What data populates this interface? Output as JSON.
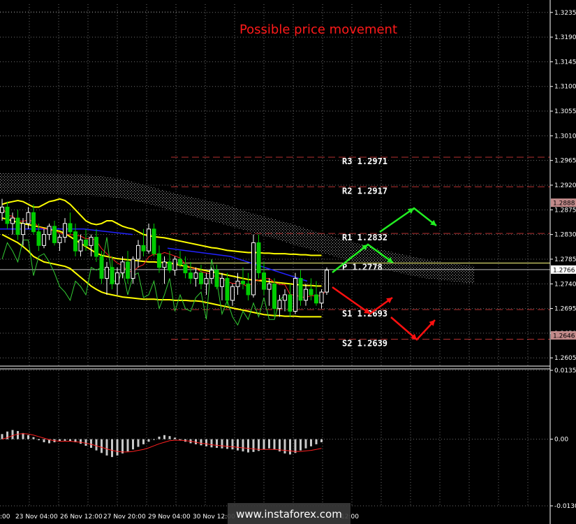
{
  "title": "Possible price movement",
  "watermark": "www.instaforex.com",
  "colors": {
    "background": "#000000",
    "grid": "#6e6e6e",
    "bull_candle": "#ffffff",
    "bear_candle": "#00cc00",
    "ichimoku_cloud": "#cccccc",
    "bollinger": "#ffff00",
    "ma_blue": "#2222ff",
    "ma_red": "#ff2020",
    "chikou_green": "#33cc33",
    "pivot_line_red": "#b33030",
    "pivot_line_yellow": "#ffff80",
    "arrow_green": "#22ee22",
    "arrow_red": "#ff1010",
    "macd_hist": "#c8c8c8",
    "macd_signal": "#ff2020"
  },
  "chart_data": {
    "type": "candlestick",
    "price_axis": {
      "ticks": [
        "1.3235",
        "1.3190",
        "1.3145",
        "1.3100",
        "1.3055",
        "1.3010",
        "1.2965",
        "1.2920",
        "1.2875",
        "1.2830",
        "1.2785",
        "1.2740",
        "1.2695",
        "1.2650",
        "1.2605"
      ],
      "min": 1.259,
      "max": 1.325,
      "current_price_tag": "1.2766",
      "tag_upper": "1.2888",
      "tag_lower": "1.2646"
    },
    "time_axis": {
      "labels": [
        ":00",
        "23 Nov 04:00",
        "26 Nov 12:00",
        "27 Nov 20:00",
        "29 Nov 04:00",
        "30 Nov 12:00",
        "",
        "",
        "12:00"
      ]
    },
    "pivot_levels": [
      {
        "name": "R3",
        "value": "1.2971",
        "label": "R3  1.2971",
        "style": "red"
      },
      {
        "name": "R2",
        "value": "1.2917",
        "label": "R2  1.2917",
        "style": "red"
      },
      {
        "name": "R1",
        "value": "1.2832",
        "label": "R1  1.2832",
        "style": "red"
      },
      {
        "name": "P",
        "value": "1.2778",
        "label": "P  1.2778",
        "style": "yellow"
      },
      {
        "name": "S1",
        "value": "1.2693",
        "label": "S1  1.2693",
        "style": "red"
      },
      {
        "name": "S2",
        "value": "1.2639",
        "label": "S2  1.2639",
        "style": "red"
      }
    ],
    "candles": [
      [
        1.287,
        1.2895,
        1.2855,
        1.288
      ],
      [
        1.288,
        1.289,
        1.284,
        1.285
      ],
      [
        1.285,
        1.287,
        1.283,
        1.286
      ],
      [
        1.286,
        1.2875,
        1.282,
        1.283
      ],
      [
        1.283,
        1.286,
        1.281,
        1.285
      ],
      [
        1.285,
        1.288,
        1.284,
        1.287
      ],
      [
        1.287,
        1.2885,
        1.283,
        1.2835
      ],
      [
        1.2835,
        1.285,
        1.28,
        1.281
      ],
      [
        1.281,
        1.284,
        1.2805,
        1.283
      ],
      [
        1.283,
        1.285,
        1.282,
        1.2845
      ],
      [
        1.2845,
        1.2855,
        1.281,
        1.2815
      ],
      [
        1.2815,
        1.283,
        1.28,
        1.2825
      ],
      [
        1.2825,
        1.286,
        1.2815,
        1.285
      ],
      [
        1.285,
        1.287,
        1.283,
        1.2835
      ],
      [
        1.2835,
        1.285,
        1.279,
        1.28
      ],
      [
        1.28,
        1.283,
        1.279,
        1.282
      ],
      [
        1.282,
        1.284,
        1.28,
        1.281
      ],
      [
        1.281,
        1.283,
        1.279,
        1.2825
      ],
      [
        1.2825,
        1.284,
        1.278,
        1.279
      ],
      [
        1.279,
        1.28,
        1.274,
        1.275
      ],
      [
        1.275,
        1.278,
        1.272,
        1.277
      ],
      [
        1.277,
        1.279,
        1.273,
        1.274
      ],
      [
        1.274,
        1.277,
        1.272,
        1.276
      ],
      [
        1.276,
        1.279,
        1.275,
        1.278
      ],
      [
        1.278,
        1.28,
        1.274,
        1.275
      ],
      [
        1.275,
        1.279,
        1.274,
        1.2785
      ],
      [
        1.2785,
        1.282,
        1.277,
        1.281
      ],
      [
        1.281,
        1.284,
        1.279,
        1.28
      ],
      [
        1.28,
        1.285,
        1.2795,
        1.284
      ],
      [
        1.284,
        1.285,
        1.279,
        1.2795
      ],
      [
        1.2795,
        1.281,
        1.276,
        1.277
      ],
      [
        1.277,
        1.279,
        1.274,
        1.278
      ],
      [
        1.278,
        1.28,
        1.276,
        1.2765
      ],
      [
        1.2765,
        1.279,
        1.2755,
        1.2785
      ],
      [
        1.2785,
        1.28,
        1.277,
        1.2775
      ],
      [
        1.2775,
        1.279,
        1.275,
        1.276
      ],
      [
        1.276,
        1.278,
        1.274,
        1.275
      ],
      [
        1.275,
        1.277,
        1.2735,
        1.276
      ],
      [
        1.276,
        1.2775,
        1.273,
        1.274
      ],
      [
        1.274,
        1.276,
        1.272,
        1.275
      ],
      [
        1.275,
        1.277,
        1.274,
        1.2765
      ],
      [
        1.2765,
        1.2775,
        1.273,
        1.2735
      ],
      [
        1.2735,
        1.276,
        1.271,
        1.275
      ],
      [
        1.275,
        1.276,
        1.27,
        1.271
      ],
      [
        1.271,
        1.274,
        1.27,
        1.2735
      ],
      [
        1.2735,
        1.276,
        1.272,
        1.2745
      ],
      [
        1.2745,
        1.277,
        1.273,
        1.274
      ],
      [
        1.274,
        1.276,
        1.271,
        1.272
      ],
      [
        1.272,
        1.283,
        1.2715,
        1.2815
      ],
      [
        1.2815,
        1.283,
        1.275,
        1.276
      ],
      [
        1.276,
        1.278,
        1.272,
        1.273
      ],
      [
        1.273,
        1.275,
        1.27,
        1.274
      ],
      [
        1.274,
        1.275,
        1.268,
        1.2695
      ],
      [
        1.2695,
        1.272,
        1.268,
        1.271
      ],
      [
        1.271,
        1.273,
        1.269,
        1.272
      ],
      [
        1.272,
        1.274,
        1.268,
        1.269
      ],
      [
        1.269,
        1.276,
        1.2685,
        1.275
      ],
      [
        1.275,
        1.2765,
        1.27,
        1.271
      ],
      [
        1.271,
        1.274,
        1.27,
        1.273
      ],
      [
        1.273,
        1.275,
        1.271,
        1.272
      ],
      [
        1.272,
        1.2745,
        1.27,
        1.2705
      ],
      [
        1.2705,
        1.273,
        1.2695,
        1.2725
      ],
      [
        1.2725,
        1.277,
        1.272,
        1.2765
      ]
    ],
    "bollinger": {
      "upper": [
        1.2885,
        1.2888,
        1.289,
        1.2892,
        1.289,
        1.2885,
        1.288,
        1.288,
        1.2885,
        1.289,
        1.2892,
        1.2895,
        1.2892,
        1.2885,
        1.2875,
        1.2865,
        1.2855,
        1.285,
        1.2848,
        1.285,
        1.2855,
        1.2855,
        1.285,
        1.2845,
        1.2842,
        1.284,
        1.2835,
        1.283,
        1.2828,
        1.2826,
        1.2825,
        1.2824,
        1.2822,
        1.282,
        1.2818,
        1.2816,
        1.2814,
        1.2812,
        1.281,
        1.2808,
        1.2806,
        1.2805,
        1.2803,
        1.2801,
        1.28,
        1.2799,
        1.2798,
        1.2797,
        1.2797,
        1.2797,
        1.2796,
        1.2796,
        1.2795,
        1.2795,
        1.2795,
        1.2794,
        1.2794,
        1.2793,
        1.2793,
        1.2792,
        1.2792,
        1.2792
      ],
      "middle": [
        1.286,
        1.2858,
        1.2855,
        1.2852,
        1.285,
        1.2848,
        1.2846,
        1.2844,
        1.2842,
        1.284,
        1.2838,
        1.2836,
        1.2832,
        1.2826,
        1.282,
        1.2814,
        1.2808,
        1.2802,
        1.2796,
        1.2792,
        1.279,
        1.2788,
        1.2786,
        1.2785,
        1.2784,
        1.2783,
        1.2782,
        1.2781,
        1.278,
        1.278,
        1.2779,
        1.2779,
        1.2778,
        1.2776,
        1.2774,
        1.2772,
        1.277,
        1.2768,
        1.2766,
        1.2764,
        1.2762,
        1.276,
        1.2758,
        1.2756,
        1.2754,
        1.2752,
        1.275,
        1.2748,
        1.2747,
        1.2746,
        1.2745,
        1.2744,
        1.2743,
        1.2742,
        1.2741,
        1.274,
        1.2739,
        1.2738,
        1.2737,
        1.2737,
        1.2736,
        1.2736
      ],
      "lower": [
        1.283,
        1.2825,
        1.282,
        1.2815,
        1.2808,
        1.28,
        1.279,
        1.2785,
        1.278,
        1.2778,
        1.2776,
        1.2774,
        1.2772,
        1.2768,
        1.276,
        1.2752,
        1.2744,
        1.2736,
        1.273,
        1.2725,
        1.2722,
        1.272,
        1.2718,
        1.2716,
        1.2715,
        1.2714,
        1.2713,
        1.2712,
        1.2712,
        1.2712,
        1.2711,
        1.2711,
        1.2711,
        1.271,
        1.271,
        1.271,
        1.2709,
        1.2709,
        1.2708,
        1.2706,
        1.2704,
        1.2702,
        1.27,
        1.2698,
        1.2696,
        1.2694,
        1.2692,
        1.269,
        1.2688,
        1.2686,
        1.2684,
        1.2683,
        1.2682,
        1.2682,
        1.2681,
        1.2681,
        1.2681,
        1.268,
        1.268,
        1.268,
        1.268,
        1.268
      ]
    },
    "arrows": {
      "green": [
        [
          [
            0,
            1.2775
          ],
          [
            1,
            1.2815
          ],
          [
            2,
            1.2785
          ]
        ],
        [
          [
            3,
            1.2888
          ],
          [
            4,
            1.286
          ]
        ]
      ],
      "red": [
        [
          [
            0,
            1.2745
          ],
          [
            1,
            1.27
          ],
          [
            2,
            1.273
          ]
        ],
        [
          [
            3,
            1.2646
          ],
          [
            4,
            1.269
          ]
        ]
      ]
    },
    "macd": {
      "axis_ticks": [
        "0.01351",
        "0.00",
        "-0.01307"
      ],
      "min": -0.01307,
      "max": 0.01351,
      "histogram": [
        0.001,
        0.0015,
        0.0018,
        0.0016,
        0.0012,
        0.0008,
        0.0004,
        -0.0002,
        -0.0006,
        -0.0008,
        -0.0006,
        -0.0004,
        -0.0003,
        -0.0004,
        -0.0006,
        -0.0009,
        -0.0013,
        -0.0017,
        -0.0022,
        -0.0027,
        -0.0032,
        -0.0035,
        -0.0032,
        -0.0028,
        -0.0024,
        -0.002,
        -0.0015,
        -0.001,
        -0.0005,
        0.0,
        0.0005,
        0.0008,
        0.0006,
        0.0003,
        -0.0002,
        -0.0005,
        -0.0008,
        -0.001,
        -0.0012,
        -0.0014,
        -0.0016,
        -0.0017,
        -0.0018,
        -0.0019,
        -0.002,
        -0.0022,
        -0.0024,
        -0.0026,
        -0.0025,
        -0.0023,
        -0.002,
        -0.0018,
        -0.002,
        -0.0024,
        -0.0028,
        -0.003,
        -0.0027,
        -0.0022,
        -0.0018,
        -0.0014,
        -0.001,
        -0.0006
      ],
      "signal": [
        0.0,
        0.0003,
        0.0007,
        0.001,
        0.0011,
        0.001,
        0.0008,
        0.0005,
        0.0002,
        -0.0001,
        -0.0003,
        -0.0004,
        -0.0004,
        -0.0004,
        -0.0005,
        -0.0006,
        -0.0008,
        -0.001,
        -0.0013,
        -0.0016,
        -0.0019,
        -0.0022,
        -0.0024,
        -0.0025,
        -0.0025,
        -0.0024,
        -0.0022,
        -0.002,
        -0.0017,
        -0.0013,
        -0.0009,
        -0.0006,
        -0.0003,
        -0.0002,
        -0.0002,
        -0.0003,
        -0.0004,
        -0.0006,
        -0.0008,
        -0.0009,
        -0.0011,
        -0.0012,
        -0.0013,
        -0.0014,
        -0.0015,
        -0.0016,
        -0.0017,
        -0.0018,
        -0.0019,
        -0.002,
        -0.002,
        -0.002,
        -0.002,
        -0.0021,
        -0.0022,
        -0.0023,
        -0.0024,
        -0.0024,
        -0.0023,
        -0.0022,
        -0.002,
        -0.0018
      ]
    }
  }
}
